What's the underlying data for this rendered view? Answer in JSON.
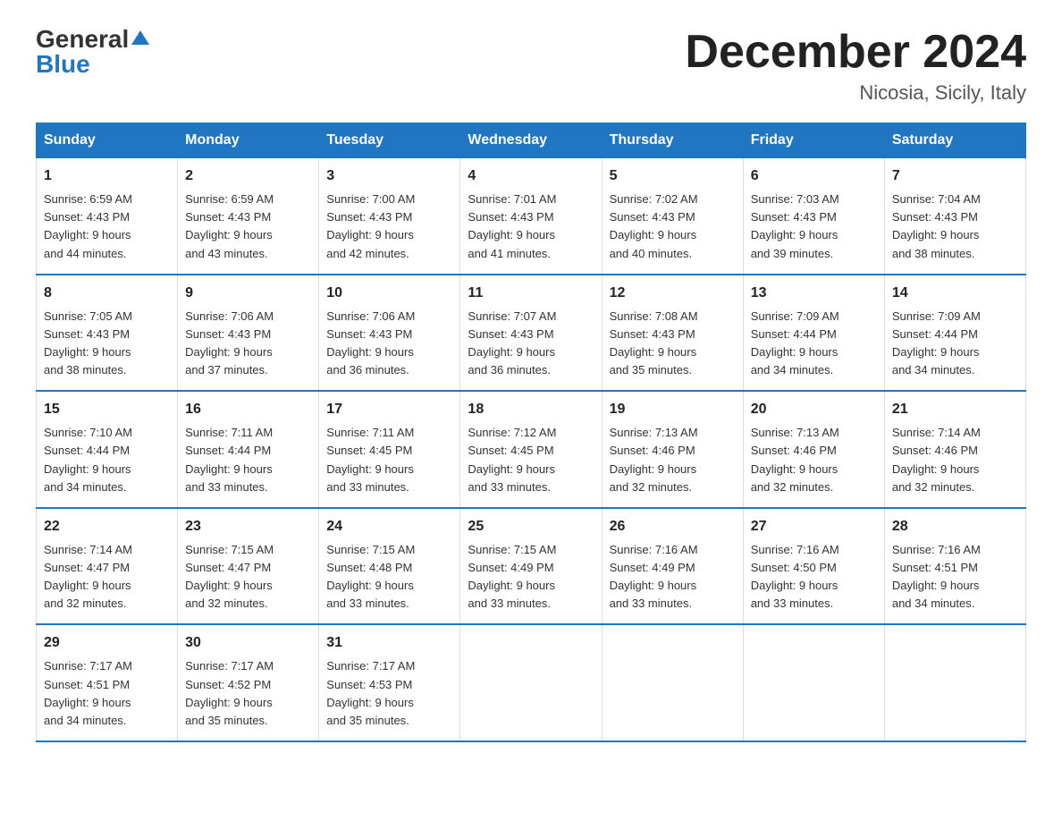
{
  "logo": {
    "general": "General",
    "blue": "Blue"
  },
  "title": "December 2024",
  "subtitle": "Nicosia, Sicily, Italy",
  "days_of_week": [
    "Sunday",
    "Monday",
    "Tuesday",
    "Wednesday",
    "Thursday",
    "Friday",
    "Saturday"
  ],
  "weeks": [
    [
      {
        "day": "1",
        "sunrise": "6:59 AM",
        "sunset": "4:43 PM",
        "daylight": "9 hours and 44 minutes."
      },
      {
        "day": "2",
        "sunrise": "6:59 AM",
        "sunset": "4:43 PM",
        "daylight": "9 hours and 43 minutes."
      },
      {
        "day": "3",
        "sunrise": "7:00 AM",
        "sunset": "4:43 PM",
        "daylight": "9 hours and 42 minutes."
      },
      {
        "day": "4",
        "sunrise": "7:01 AM",
        "sunset": "4:43 PM",
        "daylight": "9 hours and 41 minutes."
      },
      {
        "day": "5",
        "sunrise": "7:02 AM",
        "sunset": "4:43 PM",
        "daylight": "9 hours and 40 minutes."
      },
      {
        "day": "6",
        "sunrise": "7:03 AM",
        "sunset": "4:43 PM",
        "daylight": "9 hours and 39 minutes."
      },
      {
        "day": "7",
        "sunrise": "7:04 AM",
        "sunset": "4:43 PM",
        "daylight": "9 hours and 38 minutes."
      }
    ],
    [
      {
        "day": "8",
        "sunrise": "7:05 AM",
        "sunset": "4:43 PM",
        "daylight": "9 hours and 38 minutes."
      },
      {
        "day": "9",
        "sunrise": "7:06 AM",
        "sunset": "4:43 PM",
        "daylight": "9 hours and 37 minutes."
      },
      {
        "day": "10",
        "sunrise": "7:06 AM",
        "sunset": "4:43 PM",
        "daylight": "9 hours and 36 minutes."
      },
      {
        "day": "11",
        "sunrise": "7:07 AM",
        "sunset": "4:43 PM",
        "daylight": "9 hours and 36 minutes."
      },
      {
        "day": "12",
        "sunrise": "7:08 AM",
        "sunset": "4:43 PM",
        "daylight": "9 hours and 35 minutes."
      },
      {
        "day": "13",
        "sunrise": "7:09 AM",
        "sunset": "4:44 PM",
        "daylight": "9 hours and 34 minutes."
      },
      {
        "day": "14",
        "sunrise": "7:09 AM",
        "sunset": "4:44 PM",
        "daylight": "9 hours and 34 minutes."
      }
    ],
    [
      {
        "day": "15",
        "sunrise": "7:10 AM",
        "sunset": "4:44 PM",
        "daylight": "9 hours and 34 minutes."
      },
      {
        "day": "16",
        "sunrise": "7:11 AM",
        "sunset": "4:44 PM",
        "daylight": "9 hours and 33 minutes."
      },
      {
        "day": "17",
        "sunrise": "7:11 AM",
        "sunset": "4:45 PM",
        "daylight": "9 hours and 33 minutes."
      },
      {
        "day": "18",
        "sunrise": "7:12 AM",
        "sunset": "4:45 PM",
        "daylight": "9 hours and 33 minutes."
      },
      {
        "day": "19",
        "sunrise": "7:13 AM",
        "sunset": "4:46 PM",
        "daylight": "9 hours and 32 minutes."
      },
      {
        "day": "20",
        "sunrise": "7:13 AM",
        "sunset": "4:46 PM",
        "daylight": "9 hours and 32 minutes."
      },
      {
        "day": "21",
        "sunrise": "7:14 AM",
        "sunset": "4:46 PM",
        "daylight": "9 hours and 32 minutes."
      }
    ],
    [
      {
        "day": "22",
        "sunrise": "7:14 AM",
        "sunset": "4:47 PM",
        "daylight": "9 hours and 32 minutes."
      },
      {
        "day": "23",
        "sunrise": "7:15 AM",
        "sunset": "4:47 PM",
        "daylight": "9 hours and 32 minutes."
      },
      {
        "day": "24",
        "sunrise": "7:15 AM",
        "sunset": "4:48 PM",
        "daylight": "9 hours and 33 minutes."
      },
      {
        "day": "25",
        "sunrise": "7:15 AM",
        "sunset": "4:49 PM",
        "daylight": "9 hours and 33 minutes."
      },
      {
        "day": "26",
        "sunrise": "7:16 AM",
        "sunset": "4:49 PM",
        "daylight": "9 hours and 33 minutes."
      },
      {
        "day": "27",
        "sunrise": "7:16 AM",
        "sunset": "4:50 PM",
        "daylight": "9 hours and 33 minutes."
      },
      {
        "day": "28",
        "sunrise": "7:16 AM",
        "sunset": "4:51 PM",
        "daylight": "9 hours and 34 minutes."
      }
    ],
    [
      {
        "day": "29",
        "sunrise": "7:17 AM",
        "sunset": "4:51 PM",
        "daylight": "9 hours and 34 minutes."
      },
      {
        "day": "30",
        "sunrise": "7:17 AM",
        "sunset": "4:52 PM",
        "daylight": "9 hours and 35 minutes."
      },
      {
        "day": "31",
        "sunrise": "7:17 AM",
        "sunset": "4:53 PM",
        "daylight": "9 hours and 35 minutes."
      },
      null,
      null,
      null,
      null
    ]
  ],
  "labels": {
    "sunrise": "Sunrise:",
    "sunset": "Sunset:",
    "daylight": "Daylight:"
  }
}
